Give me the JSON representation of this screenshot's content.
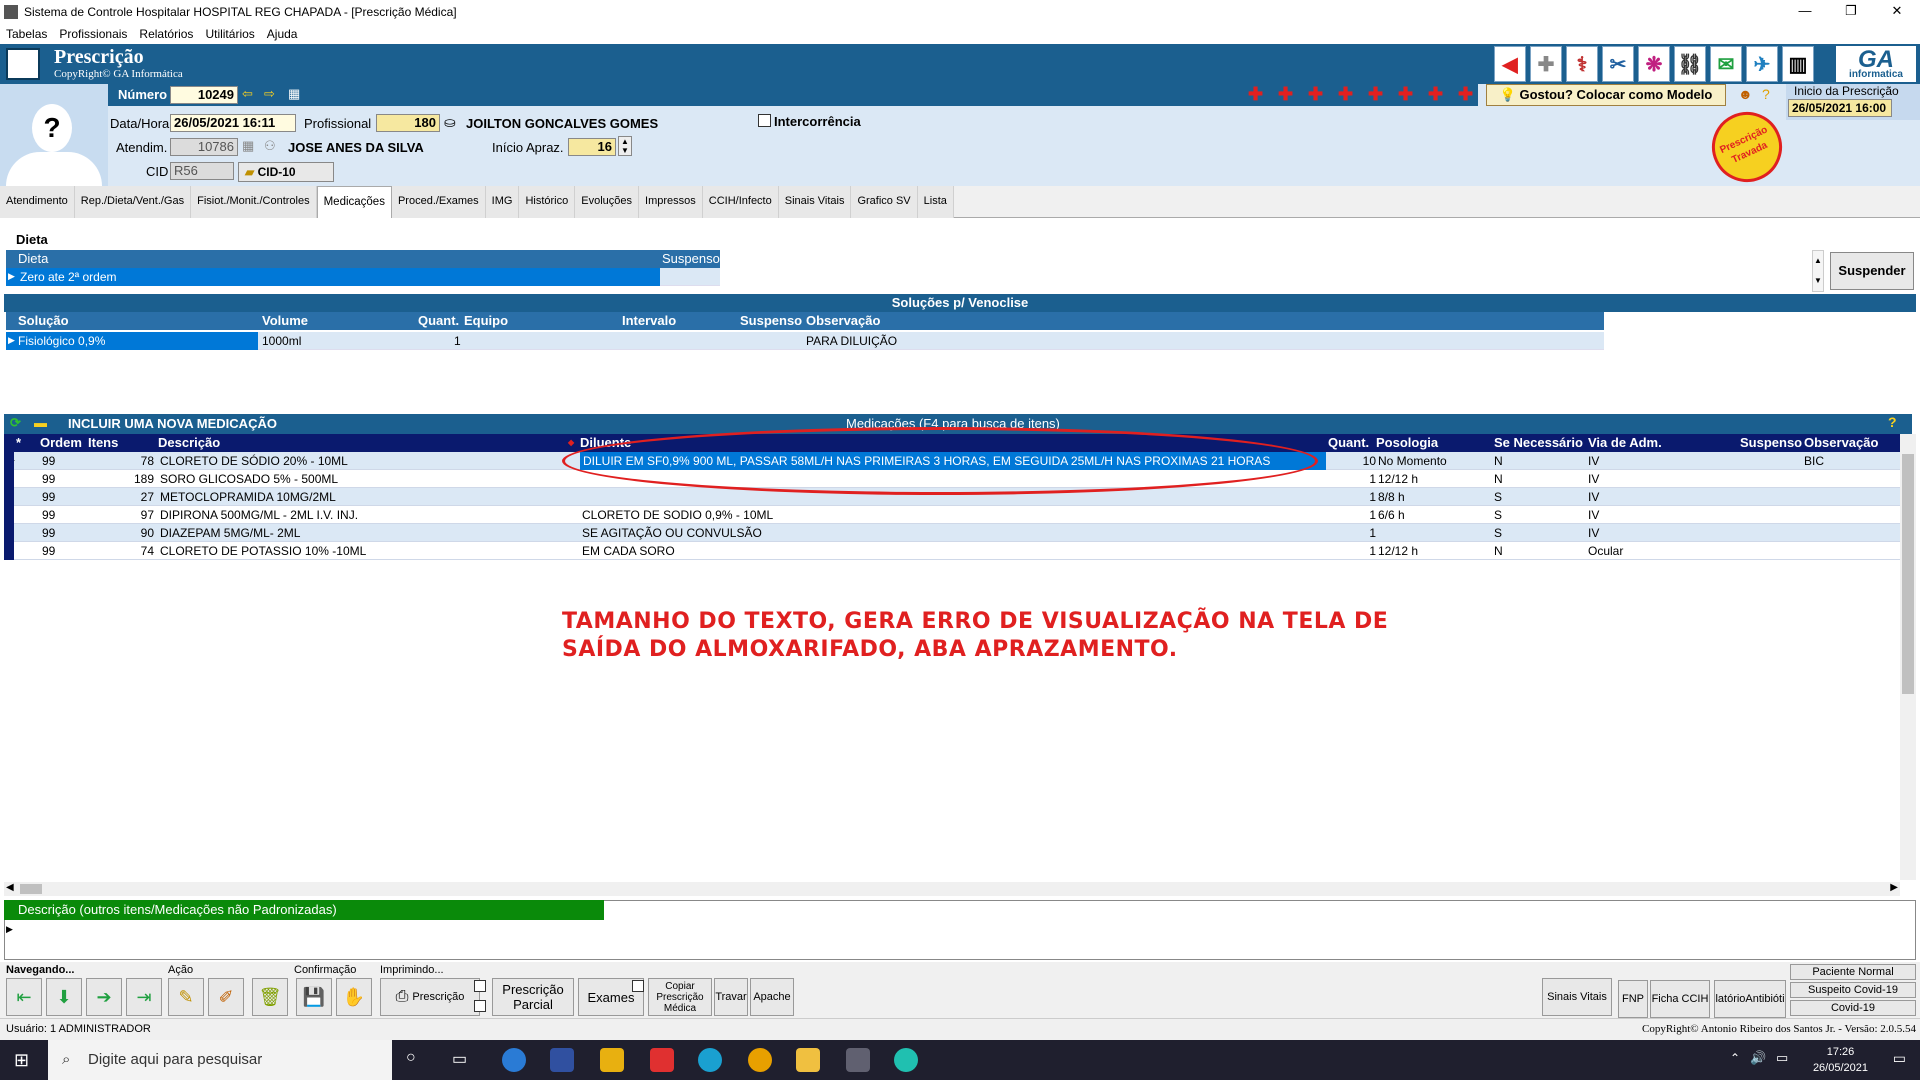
{
  "window": {
    "title": "Sistema de Controle Hospitalar HOSPITAL REG CHAPADA - [Prescrição Médica]"
  },
  "menu": [
    "Tabelas",
    "Profissionais",
    "Relatórios",
    "Utilitários",
    "Ajuda"
  ],
  "header": {
    "title": "Prescrição",
    "copyright": "CopyRight© GA Informática",
    "brand": "GA",
    "brand_sub": "informatica"
  },
  "numero": {
    "label": "Número",
    "value": "10249"
  },
  "gostou": "Gostou? Colocar como Modelo",
  "inicio_prescricao": {
    "label": "Inicio da Prescrição",
    "value": "26/05/2021 16:00"
  },
  "datahora": {
    "label": "Data/Hora",
    "value": "26/05/2021 16:11"
  },
  "profissional": {
    "label": "Profissional",
    "code": "180",
    "name": "JOILTON GONCALVES GOMES"
  },
  "intercorrencia": "Intercorrência",
  "atendim": {
    "label": "Atendim.",
    "code": "10786",
    "name": "JOSE ANES DA SILVA"
  },
  "inicio_apraz": {
    "label": "Início Apraz.",
    "value": "16"
  },
  "cid": {
    "label": "CID",
    "value": "R56",
    "button": "CID-10"
  },
  "stamp": {
    "line1": "Prescrição",
    "line2": "Travada"
  },
  "tabs": [
    "Atendimento",
    "Rep./Dieta/Vent./Gas",
    "Fisiot./Monit./Controles",
    "Medicações",
    "Proced./Exames",
    "IMG",
    "Histórico",
    "Evoluções",
    "Impressos",
    "CCIH/Infecto",
    "Sinais Vitais",
    "Grafico SV",
    "Lista"
  ],
  "active_tab": "Medicações",
  "dieta": {
    "section": "Dieta",
    "headers": [
      "Dieta",
      "Suspenso"
    ],
    "rows": [
      [
        "Zero ate 2ª ordem",
        ""
      ]
    ],
    "suspender": "Suspender"
  },
  "solucoes": {
    "section": "Soluções p/ Venoclise",
    "headers": [
      "Solução",
      "Volume",
      "Quant.",
      "Equipo",
      "Intervalo",
      "Suspenso",
      "Observação"
    ],
    "rows": [
      [
        "Fisiológico 0,9%",
        "1000ml",
        "1",
        "",
        "",
        "",
        "PARA DILUIÇÃO"
      ]
    ]
  },
  "medicacoes": {
    "incluir": "INCLUIR UMA NOVA MEDICAÇÃO",
    "title": "Medicações (F4 para busca de itens)",
    "headers": [
      "*",
      "Ordem",
      "Itens",
      "Descrição",
      "Diluente",
      "Quant.",
      "Posologia",
      "Se Necessário",
      "Via  de Adm.",
      "Suspenso",
      "Observação"
    ],
    "rows": [
      {
        "ordem": "99",
        "itens": "78",
        "descricao": "CLORETO DE SÓDIO 20% - 10ML",
        "diluente": "DILUIR EM SF0,9% 900 ML, PASSAR 58ML/H NAS PRIMEIRAS 3 HORAS, EM SEGUIDA 25ML/H NAS PROXIMAS 21 HORAS",
        "quant": "10",
        "posologia": "No Momento",
        "se_nec": "N",
        "via": "IV",
        "suspenso": "",
        "obs": "BIC"
      },
      {
        "ordem": "99",
        "itens": "189",
        "descricao": "SORO GLICOSADO 5%  - 500ML",
        "diluente": "",
        "quant": "1",
        "posologia": "12/12 h",
        "se_nec": "N",
        "via": "IV",
        "suspenso": "",
        "obs": ""
      },
      {
        "ordem": "99",
        "itens": "27",
        "descricao": "METOCLOPRAMIDA 10MG/2ML",
        "diluente": "",
        "quant": "1",
        "posologia": "8/8 h",
        "se_nec": "S",
        "via": "IV",
        "suspenso": "",
        "obs": ""
      },
      {
        "ordem": "99",
        "itens": "97",
        "descricao": "DIPIRONA 500MG/ML - 2ML I.V. INJ.",
        "diluente": "CLORETO DE SODIO 0,9%  - 10ML",
        "quant": "1",
        "posologia": "6/6 h",
        "se_nec": "S",
        "via": "IV",
        "suspenso": "",
        "obs": ""
      },
      {
        "ordem": "99",
        "itens": "90",
        "descricao": "DIAZEPAM 5MG/ML- 2ML",
        "diluente": "SE AGITAÇÃO OU CONVULSÃO",
        "quant": "1",
        "posologia": "",
        "se_nec": "S",
        "via": "IV",
        "suspenso": "",
        "obs": ""
      },
      {
        "ordem": "99",
        "itens": "74",
        "descricao": "CLORETO DE POTASSIO 10% -10ML",
        "diluente": "EM CADA SORO",
        "quant": "1",
        "posologia": "12/12 h",
        "se_nec": "N",
        "via": "Ocular",
        "suspenso": "",
        "obs": ""
      }
    ]
  },
  "annotation": {
    "line1": "TAMANHO DO TEXTO, GERA ERRO DE VISUALIZAÇÃO NA TELA DE",
    "line2": "SAÍDA DO ALMOXARIFADO, ABA APRAZAMENTO."
  },
  "descricao_outros": "Descrição (outros itens/Medicações não Padronizadas)",
  "bottom": {
    "navegando": "Navegando...",
    "acao": "Ação",
    "confirmacao": "Confirmação",
    "imprimindo": "Imprimindo...",
    "prescricao": "Prescrição",
    "prescricao_parcial": "Prescrição Parcial",
    "exames": "Exames",
    "copiar": "Copiar Prescrição Médica",
    "travar": "Travar",
    "apache": "Apache",
    "sinais_vitais": "Sinais Vitais",
    "fnp": "FNP",
    "ficha_ccih": "Ficha CCIH",
    "relatorio_antib": "latórioAntibióti",
    "paciente_normal": "Paciente Normal",
    "suspeito_covid": "Suspeito Covid-19",
    "covid": "Covid-19"
  },
  "status": {
    "usuario": "Usuário: 1  ADMINISTRADOR",
    "copyright": "CopyRight© Antonio Ribeiro dos Santos Jr. - Versão: 2.0.5.54"
  },
  "taskbar": {
    "search": "Digite aqui para pesquisar",
    "time": "17:26",
    "date": "26/05/2021"
  },
  "colors": {
    "header_blue": "#1b5f8f",
    "selection": "#0078d7",
    "annotation_red": "#e02020",
    "desc_green": "#0a8a0a"
  }
}
